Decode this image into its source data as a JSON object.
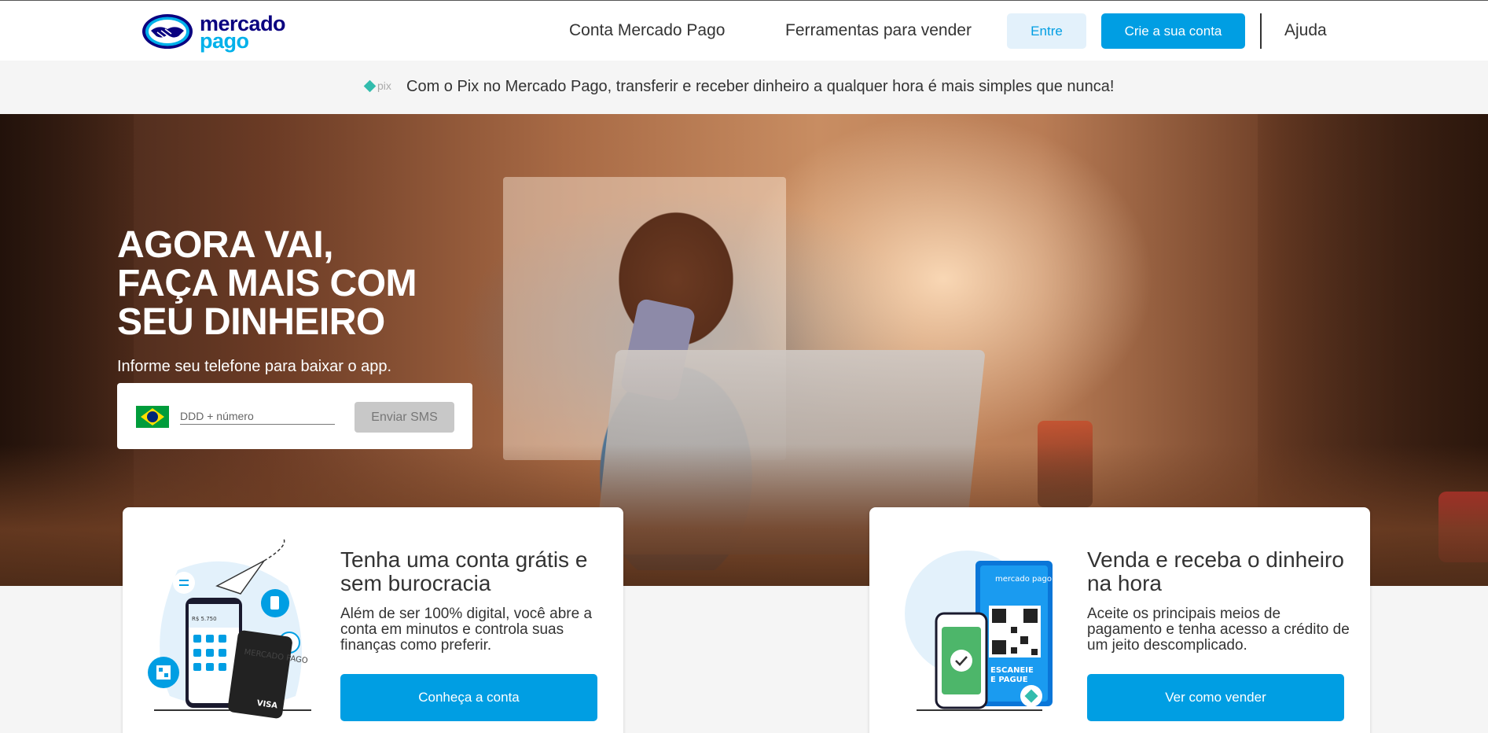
{
  "header": {
    "logo": {
      "line1": "mercado",
      "line2": "pago"
    },
    "nav": [
      "Conta Mercado Pago",
      "Ferramentas para vender"
    ],
    "login_label": "Entre",
    "signup_label": "Crie a sua conta",
    "help_label": "Ajuda"
  },
  "pix_banner": {
    "logo_text": "pix",
    "text": "Com o Pix no Mercado Pago, transferir e receber dinheiro a qualquer hora é mais simples que nunca!"
  },
  "hero": {
    "title_lines": [
      "AGORA VAI,",
      "FAÇA MAIS COM",
      "SEU DINHEIRO"
    ],
    "subtitle": "Informe seu telefone para baixar o app.",
    "phone_placeholder": "DDD + número",
    "send_label": "Enviar SMS"
  },
  "cards": [
    {
      "title": "Tenha uma conta grátis e sem burocracia",
      "text": "Além de ser 100% digital, você abre a conta em minutos e controla suas finanças como preferir.",
      "button": "Conheça a conta",
      "illustration": {
        "phone_balance": "R$ 5.750",
        "card_brand": "VISA",
        "card_text": "MERCADO PAGO"
      }
    },
    {
      "title": "Venda e receba o dinheiro na hora",
      "text": "Aceite os principais meios de pagamento e tenha acesso a crédito de um jeito descomplicado.",
      "button": "Ver como vender",
      "illustration": {
        "sign_logo": "mercado pago",
        "sign_line1": "ESCANEIE",
        "sign_line2": "E PAGUE"
      }
    }
  ],
  "colors": {
    "brand_blue": "#009ee3",
    "brand_navy": "#0a0080",
    "brand_light_blue": "#00b1ea",
    "pix_teal": "#32bcad"
  }
}
